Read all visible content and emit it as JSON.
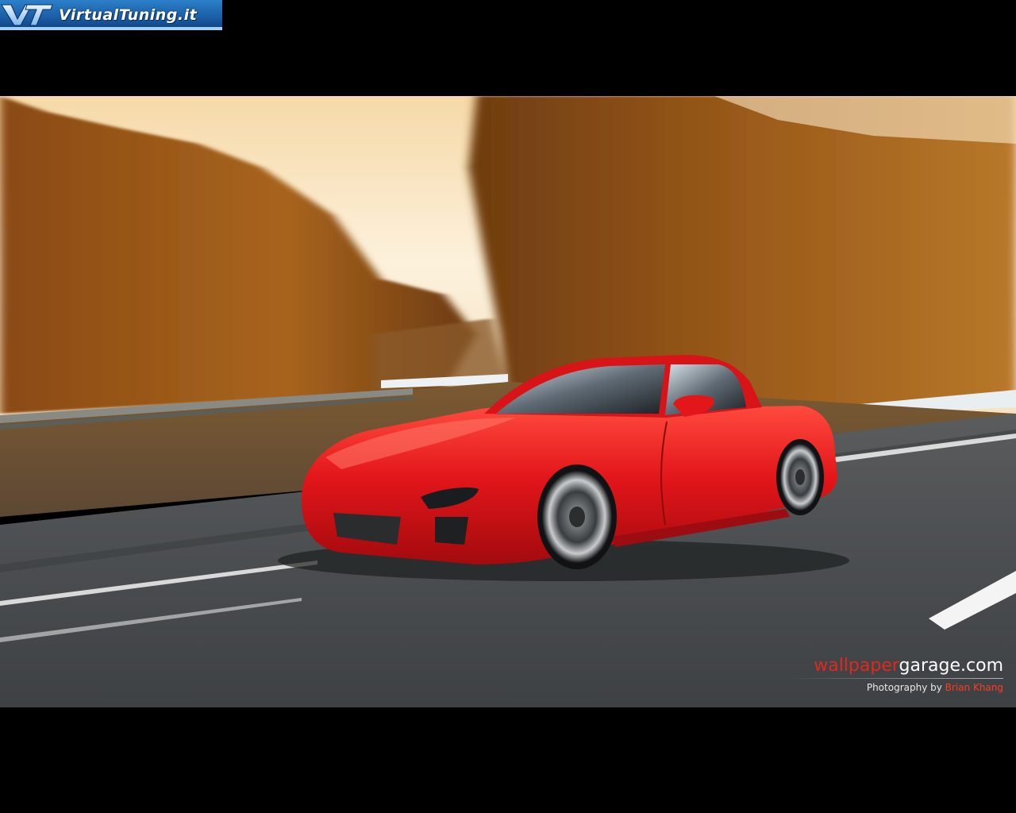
{
  "logo": {
    "text": "VirtualTuning.it",
    "mark_icon": "vt-monogram-icon"
  },
  "caption": {
    "site_red": "wallpaper",
    "site_white": "garage.com",
    "credit_prefix": "Photography by",
    "credit_name": "Brian Khang"
  },
  "colors": {
    "car_red": "#e3161a",
    "foliage": "#a6621c",
    "sky": "#fbe7c6",
    "road": "#4a4d4f",
    "caption_red": "#e0281c"
  }
}
